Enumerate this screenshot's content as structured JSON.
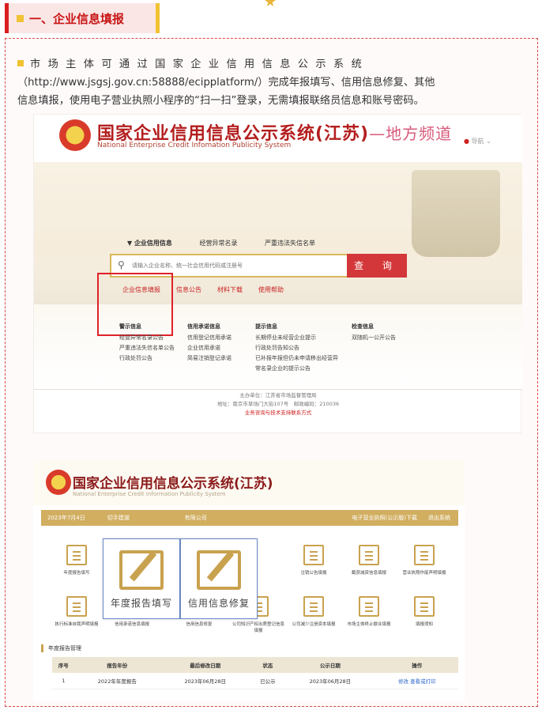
{
  "section": {
    "title": "一、企业信息填报"
  },
  "paragraph": {
    "line1": "市场主体可通过国家企业信用信息公示系统",
    "line2": "（http://www.jsgsj.gov.cn:58888/ecipplatform/）完成年报填写、信用信息修复、其他",
    "line3": "信息填报，使用电子营业执照小程序的“扫一扫”登录，无需填报联络员信息和账号密码。"
  },
  "shot1": {
    "title": "国家企业信用信息公示系统(江苏)",
    "title_suffix": "—地方频道",
    "subtitle": "National Enterprise Credit Infomation Publicity System",
    "nav": "导航",
    "tabs": [
      "▼ 企业信用信息",
      "经营异常名录",
      "严重违法失信名单"
    ],
    "search_placeholder": "请输入企业名称、统一社会信用代码或注册号",
    "search_button": "查 询",
    "links": [
      "企业信息填报",
      "信息公告",
      "材料下载",
      "使用帮助"
    ],
    "columns": [
      {
        "head": "警示信息",
        "items": [
          "经营异常名录公告",
          "严重违法失信名单公告",
          "行政处罚公告"
        ]
      },
      {
        "head": "信用承诺信息",
        "items": [
          "信用登记信用承诺",
          "企业信用承诺",
          "简易注销登记承诺"
        ]
      },
      {
        "head": "提示信息",
        "items": [
          "长期停业未经营企业提示",
          "行政处罚告知公告",
          "已补报年报但仍未申请移出经营异",
          "常名录企业的提示公告"
        ]
      },
      {
        "head": "检查信息",
        "items": [
          "双随机一公开公告"
        ]
      }
    ],
    "footer": {
      "line1": "主办单位：江苏省市场监督管理局",
      "line2": "地址：南京市草场门大街107号　邮政编码：210036",
      "line3": "业务咨询与技术支持联系方式"
    }
  },
  "shot2": {
    "title": "国家企业信用信息公示系统(江苏)",
    "subtitle": "National Enterprise Credit Information Publicity System",
    "bar_left": "2023年7月4日　　　　切手建湖　　　　　　　　　　有限公司",
    "bar_right": "电子营业执照(公示版)下载　　退出系统",
    "icons_row1": [
      "年度报告填写",
      "注销公告填报",
      "截获减资信息填报",
      "营业执照作废声明填报"
    ],
    "icons_row2": [
      "执行标准自我声明填报",
      "信用承诺信息填报",
      "信用信息修复",
      "公司知识产权出质登记信息填报",
      "公司减少注册资本填报",
      "市场主体终止歇业填报",
      "填报须知"
    ],
    "big_left": "年度报告填写",
    "big_right": "信用信息修复",
    "section_label": "年度报告管理",
    "table": {
      "headers": [
        "序号",
        "报告年份",
        "最后修改日期",
        "状态",
        "公示日期",
        "操作"
      ],
      "rows": [
        [
          "1",
          "2022年年度报告",
          "2023年06月28日",
          "已公示",
          "2023年06月28日",
          "修改  查看或打印"
        ]
      ]
    }
  }
}
